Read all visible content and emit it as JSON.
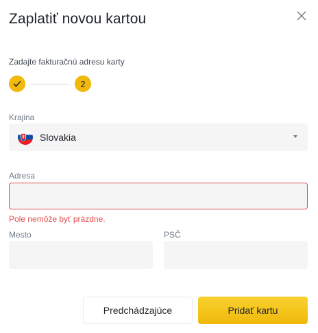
{
  "dialog": {
    "title": "Zaplatiť novou kartou",
    "close_icon": "close-icon"
  },
  "billing": {
    "subtitle": "Zadajte fakturačnú adresu karty",
    "steps": [
      {
        "label": "",
        "state": "completed",
        "icon": "check-icon"
      },
      {
        "label": "2",
        "state": "active"
      }
    ]
  },
  "form": {
    "country": {
      "label": "Krajina",
      "value": "Slovakia",
      "flag_icon": "slovakia-flag-icon"
    },
    "address": {
      "label": "Adresa",
      "value": "",
      "placeholder": "",
      "error": "Pole nemôže byť prázdne."
    },
    "city": {
      "label": "Mesto",
      "value": "",
      "placeholder": ""
    },
    "postal_code": {
      "label": "PSČ",
      "value": "",
      "placeholder": ""
    }
  },
  "buttons": {
    "back_label": "Predchádzajúce",
    "submit_label": "Pridať kartu"
  },
  "colors": {
    "accent": "#f0b90b",
    "error": "#e14c4c",
    "input_bg": "#f5f5f5"
  }
}
